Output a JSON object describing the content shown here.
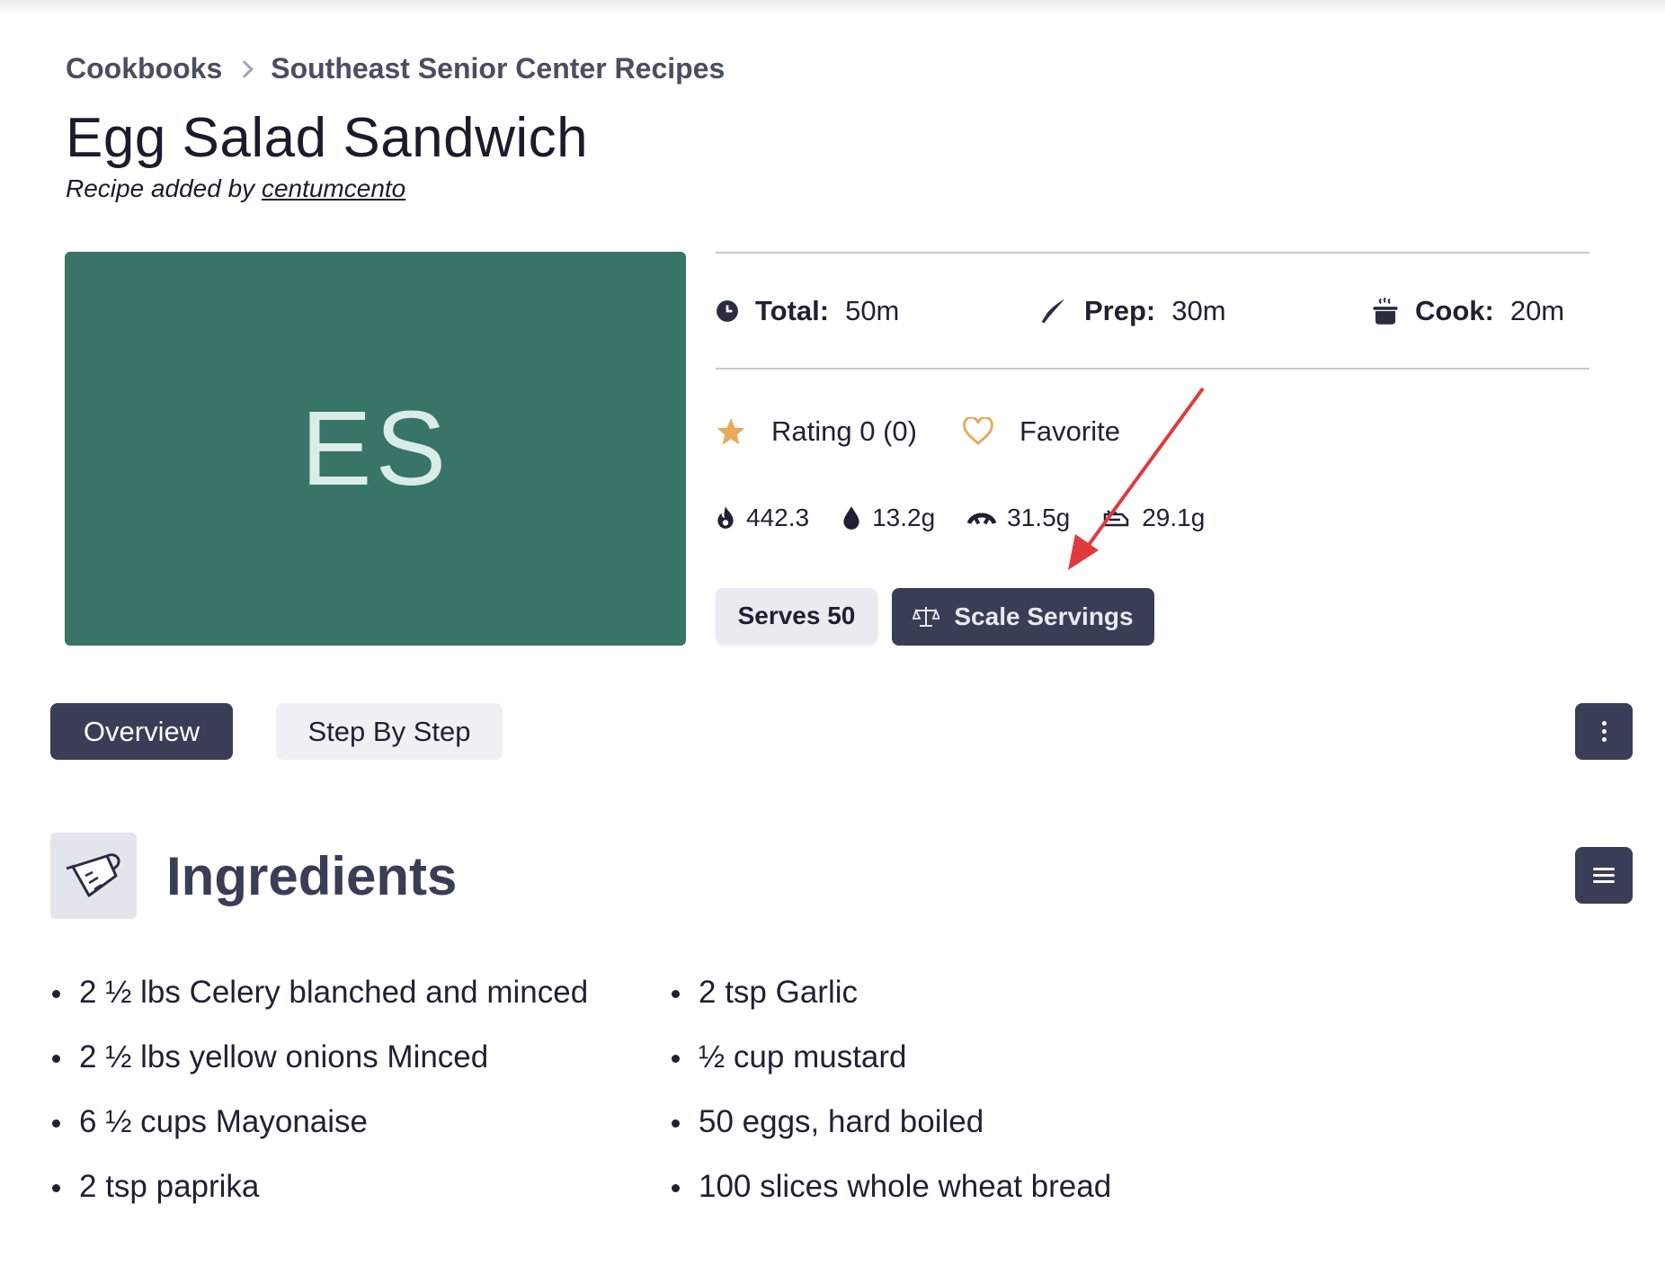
{
  "breadcrumb": {
    "root": "Cookbooks",
    "current": "Southeast Senior Center Recipes"
  },
  "recipe": {
    "title": "Egg Salad Sandwich",
    "byline_prefix": "Recipe added by",
    "author": "centumcento",
    "image_initials": "ES",
    "image_color": "#387467"
  },
  "times": {
    "total_label": "Total:",
    "total_value": "50m",
    "prep_label": "Prep:",
    "prep_value": "30m",
    "cook_label": "Cook:",
    "cook_value": "20m"
  },
  "rating": {
    "label": "Rating 0 (0)",
    "favorite_label": "Favorite"
  },
  "nutrition": {
    "calories": "442.3",
    "fat": "13.2g",
    "protein": "31.5g",
    "carbs": "29.1g"
  },
  "servings": {
    "serves_label": "Serves 50",
    "scale_label": "Scale Servings"
  },
  "tabs": {
    "overview": "Overview",
    "step_by_step": "Step By Step"
  },
  "ingredients": {
    "title": "Ingredients",
    "column1": [
      "2 ½ lbs Celery blanched and minced",
      "2 ½ lbs yellow onions Minced",
      "6 ½ cups Mayonaise",
      "2 tsp paprika"
    ],
    "column2": [
      "2 tsp Garlic",
      "½ cup mustard",
      "50 eggs, hard boiled",
      "100 slices whole wheat bread"
    ]
  },
  "colors": {
    "primary": "#3a3d56",
    "star": "#e8a95c",
    "annotation_arrow": "#e03a3e"
  }
}
